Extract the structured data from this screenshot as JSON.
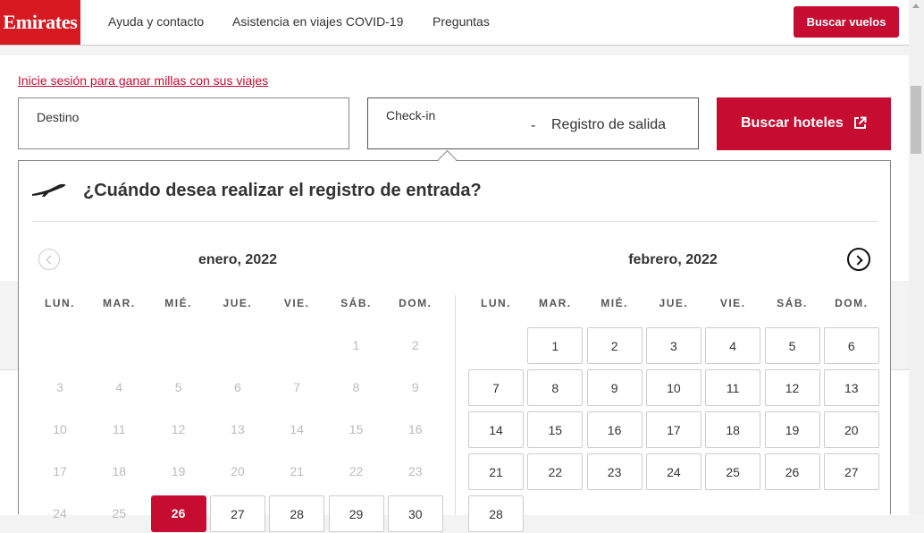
{
  "header": {
    "logo": "Emirates",
    "nav": [
      "Ayuda y contacto",
      "Asistencia en viajes COVID-19",
      "Preguntas"
    ],
    "search_flights": "Buscar vuelos"
  },
  "search": {
    "login_link": "Inicie sesión para ganar millas con sus viajes",
    "destination_label": "Destino",
    "checkin_label": "Check-in",
    "separator": "-",
    "checkout_label": "Registro de salida",
    "search_button": "Buscar hoteles"
  },
  "calendar": {
    "title": "¿Cuándo desea realizar el registro de entrada?",
    "weekdays": [
      "LUN.",
      "MAR.",
      "MIÉ.",
      "JUE.",
      "VIE.",
      "SÁB.",
      "DOM."
    ],
    "months": [
      {
        "title": "enero, 2022",
        "weeks": [
          [
            null,
            null,
            null,
            null,
            null,
            "1",
            "2"
          ],
          [
            "3",
            "4",
            "5",
            "6",
            "7",
            "8",
            "9"
          ],
          [
            "10",
            "11",
            "12",
            "13",
            "14",
            "15",
            "16"
          ],
          [
            "17",
            "18",
            "19",
            "20",
            "21",
            "22",
            "23"
          ],
          [
            "24",
            "25",
            "26",
            "27",
            "28",
            "29",
            "30"
          ]
        ],
        "first_enabled": 26,
        "selected": 26
      },
      {
        "title": "febrero, 2022",
        "weeks": [
          [
            null,
            "1",
            "2",
            "3",
            "4",
            "5",
            "6"
          ],
          [
            "7",
            "8",
            "9",
            "10",
            "11",
            "12",
            "13"
          ],
          [
            "14",
            "15",
            "16",
            "17",
            "18",
            "19",
            "20"
          ],
          [
            "21",
            "22",
            "23",
            "24",
            "25",
            "26",
            "27"
          ],
          [
            "28",
            null,
            null,
            null,
            null,
            null,
            null
          ]
        ],
        "first_enabled": 1,
        "selected": null
      }
    ]
  },
  "colors": {
    "brand": "#d71921",
    "accent": "#c60c30"
  }
}
